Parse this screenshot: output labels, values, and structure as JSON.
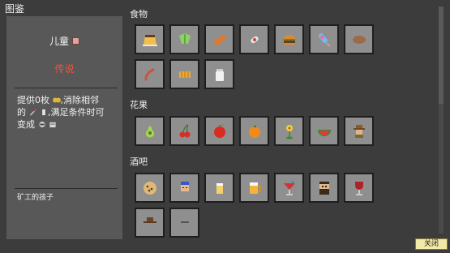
{
  "window": {
    "title": "图鉴"
  },
  "detail": {
    "name": "儿童",
    "rarity": "传说",
    "description_lines": [
      "提供0枚",
      ",消除相邻",
      "的",
      ",满足条件时可",
      "变成"
    ],
    "flavor": "矿工的孩子"
  },
  "categories": [
    {
      "title": "食物",
      "items": [
        "pudding-icon",
        "lettuce-icon",
        "bread-icon",
        "candy-icon",
        "burger-icon",
        "popsicle-icon",
        "potato-icon",
        "sausage-icon",
        "cheese-icon",
        "milk-icon"
      ]
    },
    {
      "title": "花果",
      "items": [
        "pear-icon",
        "cherry-icon",
        "apple-icon",
        "orange-icon",
        "flower-icon",
        "watermelon-icon",
        "farmer-icon"
      ]
    },
    {
      "title": "酒吧",
      "items": [
        "cookie-icon",
        "bartender-icon",
        "beer-glass-icon",
        "beer-mug-icon",
        "cocktail-icon",
        "bearded-man-icon",
        "wine-glass-icon",
        "cowboy-icon",
        "hidden-icon"
      ]
    }
  ],
  "footer": {
    "close_label": "关闭"
  },
  "colors": {
    "rarity": "#e8553f",
    "slot_bg": "#8f8f8f",
    "panel_bg": "#585858",
    "close_bg": "#f3e9a6"
  }
}
